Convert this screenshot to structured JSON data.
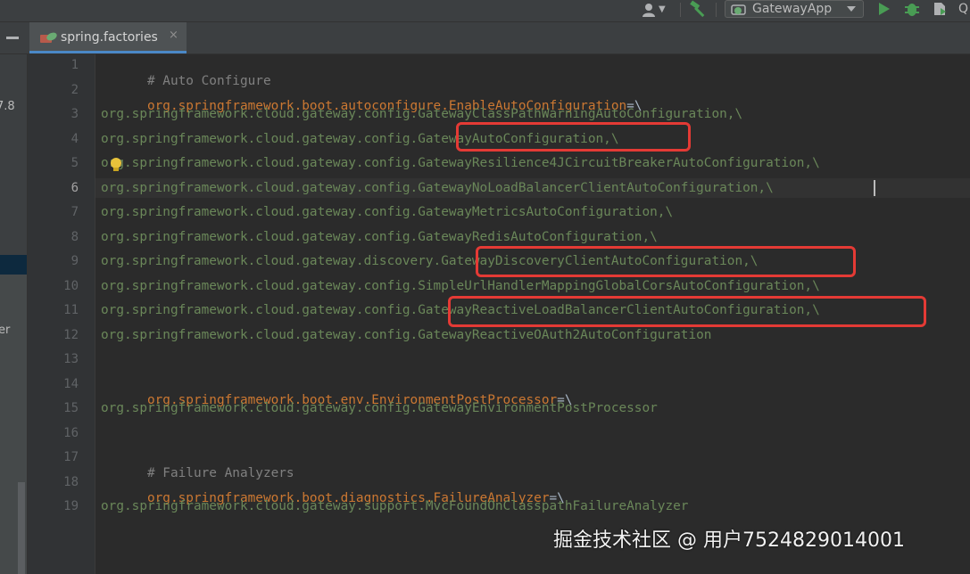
{
  "toolbar": {
    "run_config_label": "GatewayApp",
    "partial_label": "Q"
  },
  "tab": {
    "label": "spring.factories",
    "close": "×"
  },
  "left_panel": {
    "text_1": "7.8",
    "text_2": "er"
  },
  "editor": {
    "current_line": 6,
    "line_numbers": [
      "1",
      "2",
      "3",
      "4",
      "5",
      "6",
      "7",
      "8",
      "9",
      "10",
      "11",
      "12",
      "13",
      "14",
      "15",
      "16",
      "17",
      "18",
      "19"
    ],
    "lines": [
      {
        "comment": "# Auto Configure"
      },
      {
        "key": "org.springframework.boot.autoconfigure.EnableAutoConfiguration",
        "sep": "=\\"
      },
      {
        "val": "org.springframework.cloud.gateway.config.GatewayClassPathWarningAutoConfiguration,\\"
      },
      {
        "val": "org.springframework.cloud.gateway.config.GatewayAutoConfiguration,\\"
      },
      {
        "val": "org.springframework.cloud.gateway.config.GatewayResilience4JCircuitBreakerAutoConfiguration,\\"
      },
      {
        "val": "org.springframework.cloud.gateway.config.GatewayNoLoadBalancerClientAutoConfiguration,\\"
      },
      {
        "val": "org.springframework.cloud.gateway.config.GatewayMetricsAutoConfiguration,\\"
      },
      {
        "val": "org.springframework.cloud.gateway.config.GatewayRedisAutoConfiguration,\\"
      },
      {
        "val": "org.springframework.cloud.gateway.discovery.GatewayDiscoveryClientAutoConfiguration,\\"
      },
      {
        "val": "org.springframework.cloud.gateway.config.SimpleUrlHandlerMappingGlobalCorsAutoConfiguration,\\"
      },
      {
        "val": "org.springframework.cloud.gateway.config.GatewayReactiveLoadBalancerClientAutoConfiguration,\\"
      },
      {
        "val": "org.springframework.cloud.gateway.config.GatewayReactiveOAuth2AutoConfiguration"
      },
      {
        "val": ""
      },
      {
        "key": "org.springframework.boot.env.EnvironmentPostProcessor",
        "sep": "=\\"
      },
      {
        "val": "org.springframework.cloud.gateway.config.GatewayEnvironmentPostProcessor"
      },
      {
        "val": ""
      },
      {
        "comment": "# Failure Analyzers"
      },
      {
        "key": "org.springframework.boot.diagnostics.FailureAnalyzer",
        "sep": "=\\"
      },
      {
        "val": "org.springframework.cloud.gateway.support.MvcFoundOnClasspathFailureAnalyzer"
      }
    ]
  },
  "colors": {
    "comment": "#808080",
    "key": "#cc7832",
    "value": "#6a8759",
    "highlight_box": "#e43a35",
    "tab_underline": "#4a88c7"
  },
  "watermark": "掘金技术社区 @ 用户7524829014001"
}
